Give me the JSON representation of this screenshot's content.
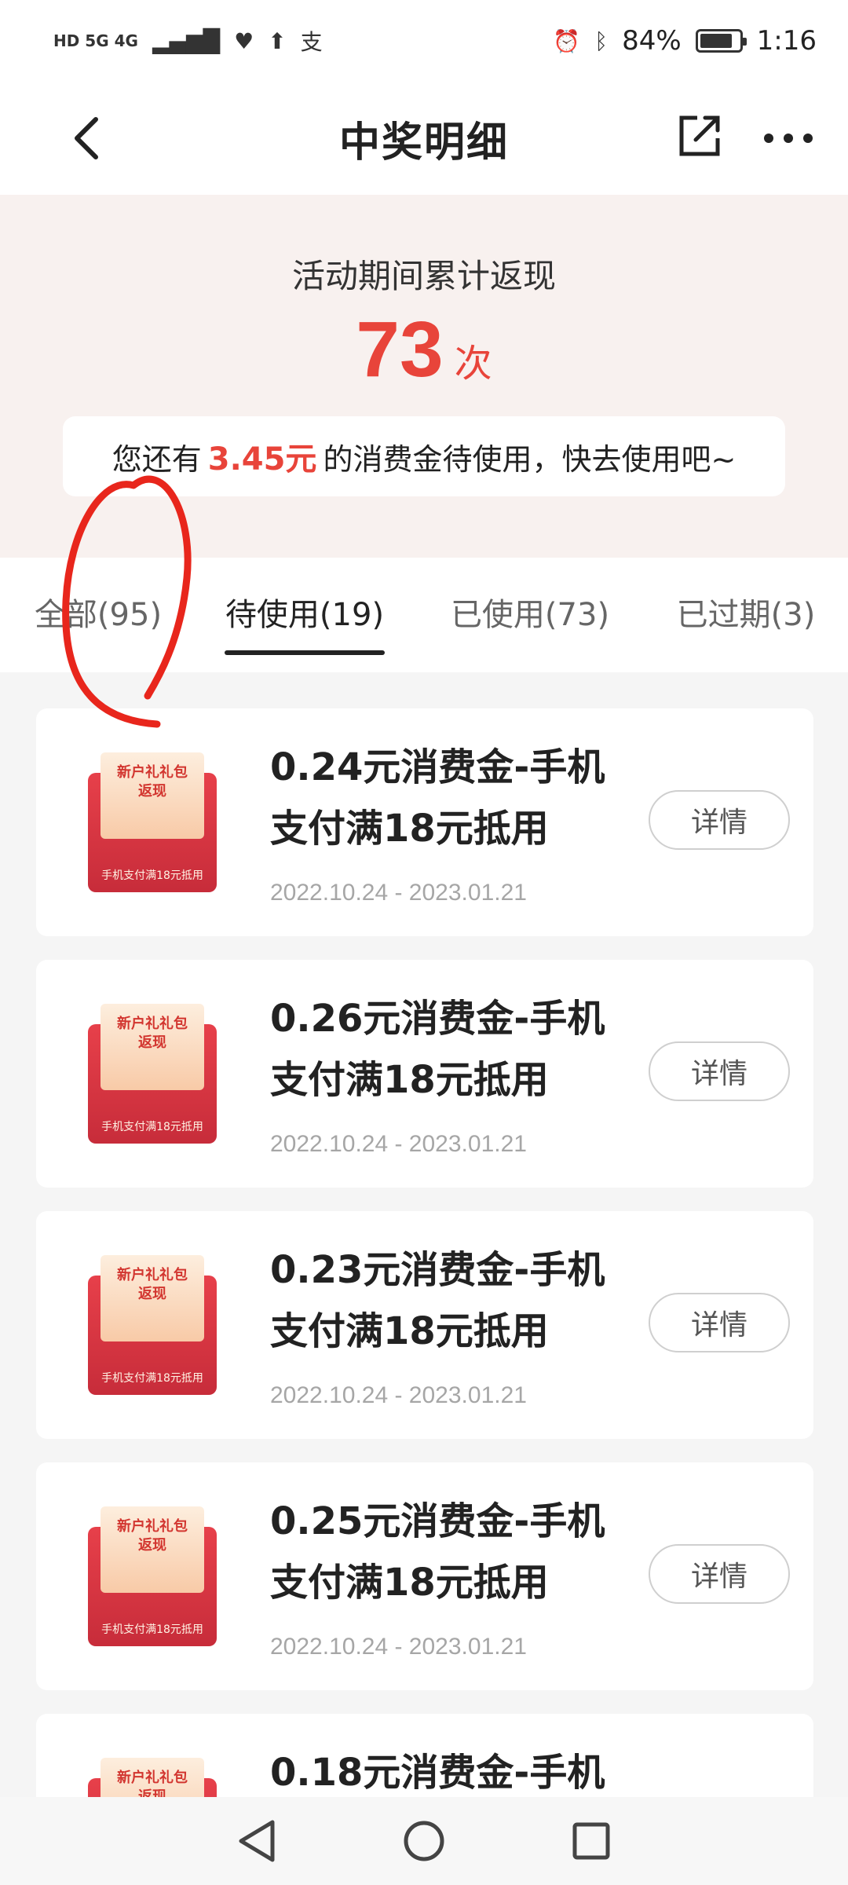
{
  "status_bar": {
    "net_left": "HD 5G 4G",
    "battery": "84%",
    "battery_level": 0.84,
    "time": "1:16"
  },
  "nav": {
    "title": "中奖明细"
  },
  "summary": {
    "label": "活动期间累计返现",
    "count": "73",
    "count_unit": "次",
    "notice_prefix": "您还有",
    "notice_amount": "3.45元",
    "notice_suffix": "的消费金待使用，快去使用吧~"
  },
  "tabs": [
    {
      "label": "全部(95)"
    },
    {
      "label": "待使用(19)"
    },
    {
      "label": "已使用(73)"
    },
    {
      "label": "已过期(3)"
    }
  ],
  "active_tab": "待使用(19)",
  "thumb": {
    "line1": "新户礼礼包",
    "line2": "返现",
    "caption": "手机支付满18元抵用"
  },
  "items": [
    {
      "title_line1": "0.24元消费金-手机",
      "title_line2": "支付满18元抵用",
      "date": "2022.10.24 - 2023.01.21",
      "button": "详情"
    },
    {
      "title_line1": "0.26元消费金-手机",
      "title_line2": "支付满18元抵用",
      "date": "2022.10.24 - 2023.01.21",
      "button": "详情"
    },
    {
      "title_line1": "0.23元消费金-手机",
      "title_line2": "支付满18元抵用",
      "date": "2022.10.24 - 2023.01.21",
      "button": "详情"
    },
    {
      "title_line1": "0.25元消费金-手机",
      "title_line2": "支付满18元抵用",
      "date": "2022.10.24 - 2023.01.21",
      "button": "详情"
    },
    {
      "title_line1": "0.18元消费金-手机",
      "title_line2": "",
      "date": "",
      "button": ""
    }
  ],
  "colors": {
    "accent": "#e8443a",
    "summary_bg": "#f8f1ef",
    "annotation": "#e8261c"
  }
}
